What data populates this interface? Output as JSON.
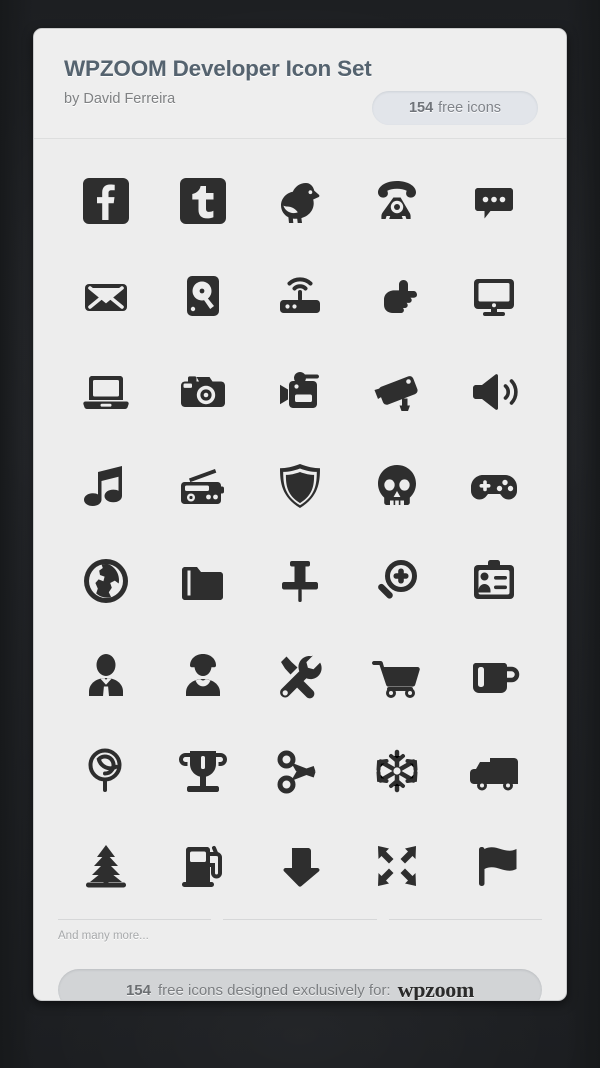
{
  "window": {
    "background_color": "#212326",
    "card_background": "#ededed",
    "icon_color": "#2e2e2e",
    "title_color": "#55636f"
  },
  "header": {
    "title": "WPZOOM Developer Icon Set",
    "byline": "by David Ferreira",
    "badge": {
      "count": "154",
      "label": "free icons"
    }
  },
  "grid": {
    "rows": [
      [
        {
          "name": "facebook-icon",
          "label": "Facebook"
        },
        {
          "name": "twitter-icon",
          "label": "Twitter"
        },
        {
          "name": "bird-icon",
          "label": "Bird"
        },
        {
          "name": "rotary-telephone-icon",
          "label": "Telephone"
        },
        {
          "name": "speech-bubble-icon",
          "label": "Comments"
        }
      ],
      [
        {
          "name": "envelope-icon",
          "label": "Mail"
        },
        {
          "name": "hard-drive-icon",
          "label": "Hard Drive"
        },
        {
          "name": "wifi-router-icon",
          "label": "Wireless Router"
        },
        {
          "name": "pointing-hand-icon",
          "label": "Pointing Hand"
        },
        {
          "name": "desktop-monitor-icon",
          "label": "Desktop Monitor"
        }
      ],
      [
        {
          "name": "laptop-icon",
          "label": "Laptop"
        },
        {
          "name": "photo-camera-icon",
          "label": "Photo Camera"
        },
        {
          "name": "video-camera-icon",
          "label": "Video Camera"
        },
        {
          "name": "security-camera-icon",
          "label": "Security Camera"
        },
        {
          "name": "speaker-volume-icon",
          "label": "Volume"
        }
      ],
      [
        {
          "name": "music-note-icon",
          "label": "Music"
        },
        {
          "name": "radio-icon",
          "label": "Radio"
        },
        {
          "name": "shield-icon",
          "label": "Shield"
        },
        {
          "name": "skull-icon",
          "label": "Skull"
        },
        {
          "name": "gamepad-icon",
          "label": "Gamepad"
        }
      ],
      [
        {
          "name": "globe-icon",
          "label": "Globe"
        },
        {
          "name": "folder-icon",
          "label": "Folder"
        },
        {
          "name": "pushpin-icon",
          "label": "Pin"
        },
        {
          "name": "zoom-in-icon",
          "label": "Zoom In"
        },
        {
          "name": "id-card-icon",
          "label": "ID Card"
        }
      ],
      [
        {
          "name": "businessman-icon",
          "label": "Businessman"
        },
        {
          "name": "woman-user-icon",
          "label": "Woman"
        },
        {
          "name": "tools-icon",
          "label": "Tools"
        },
        {
          "name": "shopping-cart-icon",
          "label": "Shopping Cart"
        },
        {
          "name": "coffee-mug-icon",
          "label": "Coffee"
        }
      ],
      [
        {
          "name": "lollipop-icon",
          "label": "Lollipop"
        },
        {
          "name": "trophy-icon",
          "label": "Trophy"
        },
        {
          "name": "scissors-icon",
          "label": "Scissors"
        },
        {
          "name": "snowflake-icon",
          "label": "Snowflake"
        },
        {
          "name": "delivery-truck-icon",
          "label": "Delivery Truck"
        }
      ],
      [
        {
          "name": "pine-tree-icon",
          "label": "Tree"
        },
        {
          "name": "fuel-pump-icon",
          "label": "Fuel"
        },
        {
          "name": "down-arrow-icon",
          "label": "Download"
        },
        {
          "name": "collapse-arrows-icon",
          "label": "Collapse"
        },
        {
          "name": "flag-icon",
          "label": "Flag"
        }
      ]
    ]
  },
  "more": {
    "text": "And many more..."
  },
  "footer": {
    "count": "154",
    "text": "free icons designed exclusively for:",
    "brand": "wpzoom"
  }
}
